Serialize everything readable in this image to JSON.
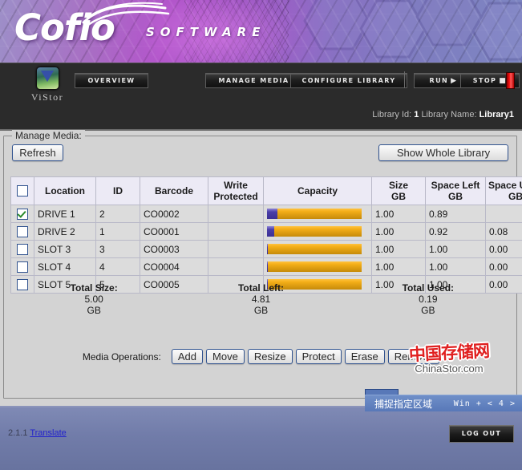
{
  "banner": {
    "brand": "Cofio",
    "subtitle": "SOFTWARE",
    "accent_color": "#9b55c0"
  },
  "nav": {
    "vendor_label": "ViStor",
    "vendor_icon": "vistor-logo-icon",
    "buttons": [
      {
        "id": "overview",
        "label": "OVERVIEW"
      },
      {
        "id": "manage-media",
        "label": "MANAGE MEDIA"
      },
      {
        "id": "configure-library",
        "label": "CONFIGURE LIBRARY"
      }
    ],
    "run_label": "RUN",
    "run_glyph": "▶",
    "stop_label": "STOP",
    "stop_glyph": "■",
    "status_led_color": "#ff1515",
    "library_id_label": "Library Id:",
    "library_id_value": "1",
    "library_name_label": "Library Name:",
    "library_name_value": "Library1"
  },
  "panel": {
    "legend": "Manage Media:",
    "refresh_label": "Refresh",
    "show_whole_library_label": "Show Whole Library"
  },
  "table": {
    "headers": {
      "select_all": "",
      "location": "Location",
      "id": "ID",
      "barcode": "Barcode",
      "write_protected_line1": "Write",
      "write_protected_line2": "Protected",
      "capacity": "Capacity",
      "size_line1": "Size",
      "size_line2": "GB",
      "space_left_line1": "Space Left",
      "space_left_line2": "GB",
      "space_used_line1": "Space Used",
      "space_used_line2": "GB"
    },
    "rows": [
      {
        "checked": true,
        "location": "DRIVE 1",
        "id": "2",
        "barcode": "CO0002",
        "write_protected": "",
        "used_pct": 11,
        "size": "1.00",
        "space_left": "0.89",
        "space_used": ""
      },
      {
        "checked": false,
        "location": "DRIVE 2",
        "id": "1",
        "barcode": "CO0001",
        "write_protected": "",
        "used_pct": 8,
        "size": "1.00",
        "space_left": "0.92",
        "space_used": "0.08"
      },
      {
        "checked": false,
        "location": "SLOT 3",
        "id": "3",
        "barcode": "CO0003",
        "write_protected": "",
        "used_pct": 1,
        "size": "1.00",
        "space_left": "1.00",
        "space_used": "0.00"
      },
      {
        "checked": false,
        "location": "SLOT 4",
        "id": "4",
        "barcode": "CO0004",
        "write_protected": "",
        "used_pct": 1,
        "size": "1.00",
        "space_left": "1.00",
        "space_used": "0.00"
      },
      {
        "checked": false,
        "location": "SLOT 5",
        "id": "5",
        "barcode": "CO0005",
        "write_protected": "",
        "used_pct": 1,
        "size": "1.00",
        "space_left": "1.00",
        "space_used": "0.00"
      }
    ]
  },
  "totals": [
    {
      "label": "Total Size:",
      "value": "5.00",
      "unit": "GB"
    },
    {
      "label": "Total Left:",
      "value": "4.81",
      "unit": "GB"
    },
    {
      "label": "Total Used:",
      "value": "0.19",
      "unit": "GB"
    }
  ],
  "media_operations": {
    "label": "Media Operations:",
    "buttons": [
      "Add",
      "Move",
      "Resize",
      "Protect",
      "Erase",
      "Remove"
    ]
  },
  "capture_overlay": {
    "label": "捕捉指定区域",
    "shortcut": "Win + < 4 >"
  },
  "watermark": {
    "chinese": "中国存储网",
    "english": "ChinaStor.com"
  },
  "footer": {
    "version": "2.1.1",
    "translate_label": "Translate",
    "logout_label": "LOG OUT"
  }
}
